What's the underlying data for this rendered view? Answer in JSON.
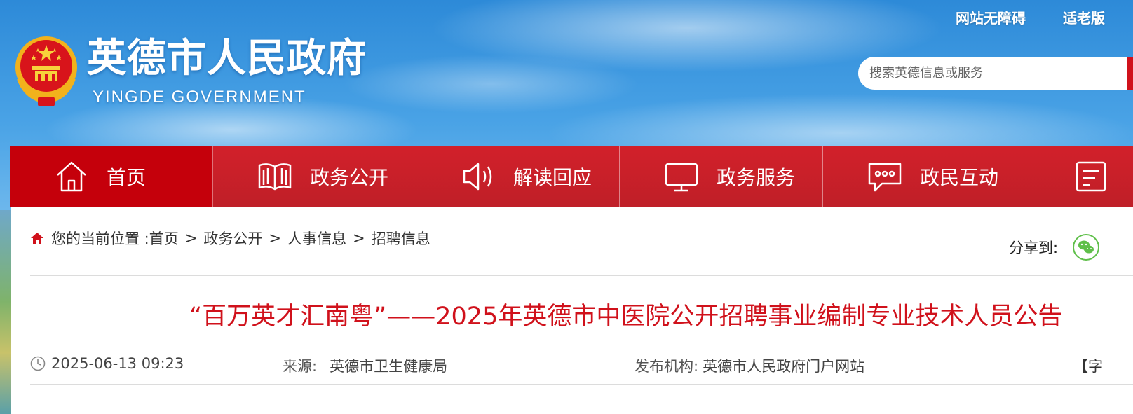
{
  "header": {
    "title": "英德市人民政府",
    "subtitle": "YINGDE GOVERNMENT",
    "links": [
      "网站无障碍",
      "适老版"
    ],
    "search_placeholder": "搜索英德信息或服务"
  },
  "nav": {
    "items": [
      {
        "label": "首页",
        "icon": "home-icon",
        "active": true
      },
      {
        "label": "政务公开",
        "icon": "book-icon"
      },
      {
        "label": "解读回应",
        "icon": "speaker-icon"
      },
      {
        "label": "政务服务",
        "icon": "monitor-icon"
      },
      {
        "label": "政民互动",
        "icon": "chat-icon"
      }
    ],
    "last_partial_icon": "checklist-icon"
  },
  "breadcrumb": {
    "prefix": "您的当前位置 : ",
    "items": [
      "首页",
      "政务公开",
      "人事信息",
      "招聘信息"
    ],
    "separator": ">"
  },
  "share": {
    "label": "分享到:",
    "icon": "wechat-icon"
  },
  "article": {
    "title": "“百万英才汇南粤”——2025年英德市中医院公开招聘事业编制专业技术人员公告",
    "date": "2025-06-13 09:23",
    "source_label": "来源:",
    "source": "英德市卫生健康局",
    "publisher_label": "发布机构:",
    "publisher": "英德市人民政府门户网站",
    "font_size_control": "【字"
  },
  "colors": {
    "accent": "#d0111b",
    "nav": "#c91f29",
    "nav_active": "#c5000b"
  }
}
